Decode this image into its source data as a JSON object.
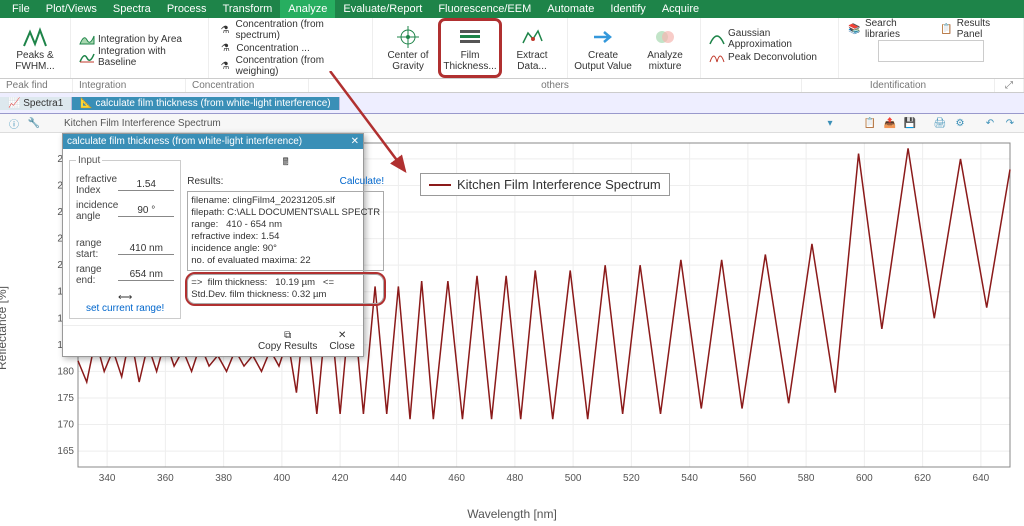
{
  "menu": [
    "File",
    "Plot/Views",
    "Spectra",
    "Process",
    "Transform",
    "Analyze",
    "Evaluate/Report",
    "Fluorescence/EEM",
    "Automate",
    "Identify",
    "Acquire"
  ],
  "menu_active_index": 5,
  "ribbon": {
    "peaks_fwhm": "Peaks &\nFWHM...",
    "int_area": "Integration by\nArea",
    "int_baseline": "Integration\nwith Baseline",
    "conc_spectrum": "Concentration\n(from spectrum)",
    "conc_": "Concentration\n...",
    "conc_weighing": "Concentration\n(from weighing)",
    "center_gravity": "Center of\nGravity",
    "film_thickness": "Film\nThickness...",
    "extract_data": "Extract\nData...",
    "create_output": "Create\nOutput\nValue",
    "analyze_mixture": "Analyze\nmixture",
    "gaussian": "Gaussian\nApproximation",
    "peak_deconv": "Peak\nDeconvolution",
    "search_lib": "Search\nlibraries",
    "results_panel": "Results\nPanel"
  },
  "groups": {
    "peakfind": "Peak find",
    "integration": "Integration",
    "concentration": "Concentration",
    "others": "others",
    "identification": "Identification"
  },
  "tabs": {
    "spectra1": "Spectra1",
    "dialog_tab": "calculate film thickness (from white-light interference)"
  },
  "doc_title": "Kitchen Film Interference Spectrum",
  "dialog": {
    "title": "calculate film thickness (from white-light interference)",
    "input_legend": "Input",
    "refr_label": "refractive Index",
    "refr_val": "1.54",
    "angle_label": "incidence angle",
    "angle_val": "90 °",
    "rstart_label": "range start:",
    "rstart_val": "410 nm",
    "rend_label": "range end:",
    "rend_val": "654 nm",
    "set_range": "set current range!",
    "results_label": "Results:",
    "calc_btn": "Calculate!",
    "results_text": "filename: clingFilm4_20231205.slf\nfilepath: C:\\ALL DOCUMENTS\\ALL SPECTR\nrange:   410 - 654 nm\nrefractive index: 1.54\nincidence angle: 90°\nno. of evaluated maxima: 22",
    "film_line": "=>  film thickness:   10.19 µm   <=\nStd.Dev. film thickness: 0.32 µm",
    "copy": "Copy Results",
    "close": "Close"
  },
  "legend": "Kitchen Film Interference Spectrum",
  "axes": {
    "x": "Wavelength [nm]",
    "y": "Reflectance [%]"
  },
  "chart_data": {
    "type": "line",
    "title": "Kitchen Film Interference Spectrum",
    "xlabel": "Wavelength [nm]",
    "ylabel": "Reflectance [%]",
    "xlim": [
      330,
      650
    ],
    "ylim": [
      162,
      223
    ],
    "x_ticks": [
      340,
      360,
      380,
      400,
      420,
      440,
      460,
      480,
      500,
      520,
      540,
      560,
      580,
      600,
      620,
      640
    ],
    "y_ticks": [
      165,
      170,
      175,
      180,
      185,
      190,
      195,
      200,
      205,
      210,
      215,
      220
    ],
    "series": [
      {
        "name": "Kitchen Film Interference Spectrum",
        "color": "#8b1a1a",
        "x": [
          330,
          333,
          336,
          339,
          342,
          345,
          348,
          351,
          354,
          357,
          360,
          363,
          366,
          369,
          372,
          375,
          378,
          381,
          384,
          387,
          390,
          393,
          396,
          399,
          402,
          405,
          408,
          412,
          416,
          420,
          424,
          428,
          432,
          436,
          440,
          444,
          448,
          452,
          457,
          462,
          467,
          472,
          477,
          482,
          487,
          493,
          499,
          505,
          511,
          517,
          523,
          530,
          537,
          544,
          551,
          558,
          566,
          574,
          582,
          590,
          598,
          606,
          615,
          624,
          633,
          642,
          650
        ],
        "y": [
          182,
          178,
          186,
          180,
          184,
          179,
          187,
          178,
          185,
          180,
          186,
          181,
          184,
          180,
          185,
          181,
          183,
          180,
          184,
          181,
          183,
          180,
          184,
          181,
          186,
          176,
          192,
          172,
          195,
          172,
          196,
          172,
          196,
          172,
          196,
          171,
          197,
          171,
          197,
          171,
          198,
          171,
          198,
          171,
          199,
          171,
          199,
          171,
          200,
          172,
          200,
          172,
          201,
          173,
          201,
          173,
          202,
          174,
          204,
          176,
          221,
          188,
          222,
          190,
          220,
          192,
          218
        ]
      }
    ]
  }
}
